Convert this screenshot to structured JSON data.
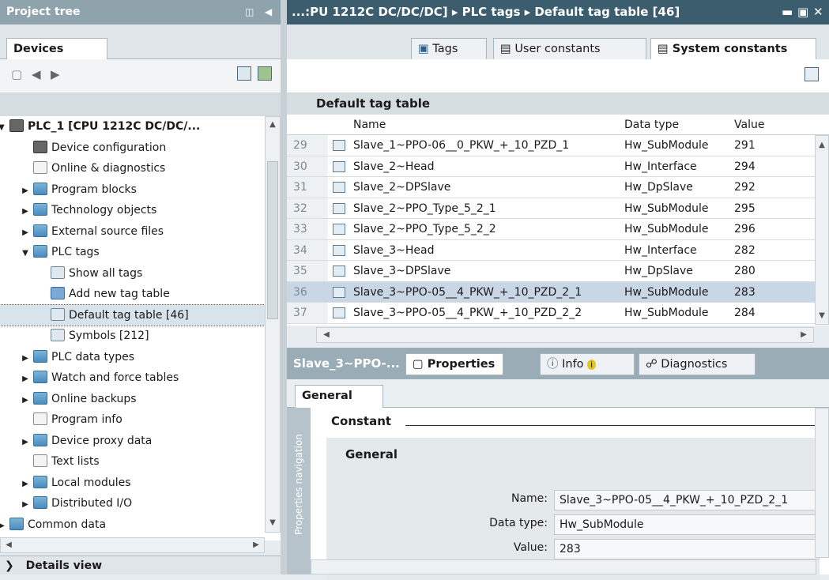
{
  "left": {
    "title": "Project tree",
    "tab": "Devices",
    "tree": [
      {
        "label": "PLC_1 [CPU 1212C DC/DC/...",
        "level": 0,
        "expand": "open",
        "icon": "cpu-icon"
      },
      {
        "label": "Device configuration",
        "level": 1,
        "expand": "",
        "icon": "device-config-icon"
      },
      {
        "label": "Online & diagnostics",
        "level": 1,
        "expand": "",
        "icon": "diagnostics-icon"
      },
      {
        "label": "Program blocks",
        "level": 1,
        "expand": "closed",
        "icon": "folder-icon"
      },
      {
        "label": "Technology objects",
        "level": 1,
        "expand": "closed",
        "icon": "folder-icon"
      },
      {
        "label": "External source files",
        "level": 1,
        "expand": "closed",
        "icon": "folder-icon"
      },
      {
        "label": "PLC tags",
        "level": 1,
        "expand": "open",
        "icon": "folder-icon"
      },
      {
        "label": "Show all tags",
        "level": 2,
        "expand": "",
        "icon": "tags-icon"
      },
      {
        "label": "Add new tag table",
        "level": 2,
        "expand": "",
        "icon": "add-table-icon"
      },
      {
        "label": "Default tag table [46]",
        "level": 2,
        "expand": "",
        "icon": "tag-table-icon",
        "selected": true
      },
      {
        "label": "Symbols [212]",
        "level": 2,
        "expand": "",
        "icon": "tag-table-icon"
      },
      {
        "label": "PLC data types",
        "level": 1,
        "expand": "closed",
        "icon": "folder-icon"
      },
      {
        "label": "Watch and force tables",
        "level": 1,
        "expand": "closed",
        "icon": "folder-icon"
      },
      {
        "label": "Online backups",
        "level": 1,
        "expand": "closed",
        "icon": "folder-icon"
      },
      {
        "label": "Program info",
        "level": 1,
        "expand": "",
        "icon": "program-info-icon"
      },
      {
        "label": "Device proxy data",
        "level": 1,
        "expand": "closed",
        "icon": "folder-icon"
      },
      {
        "label": "Text lists",
        "level": 1,
        "expand": "",
        "icon": "text-list-icon"
      },
      {
        "label": "Local modules",
        "level": 1,
        "expand": "closed",
        "icon": "folder-icon"
      },
      {
        "label": "Distributed I/O",
        "level": 1,
        "expand": "closed",
        "icon": "folder-icon"
      },
      {
        "label": "Common data",
        "level": 0,
        "expand": "closed",
        "icon": "folder-icon"
      }
    ],
    "details": "Details view"
  },
  "main": {
    "breadcrumb": "...:PU 1212C DC/DC/DC] ▸ PLC tags ▸ Default tag table [46]",
    "tabs": [
      "Tags",
      "User constants",
      "System constants"
    ],
    "table_title": "Default tag table",
    "columns": [
      "Name",
      "Data type",
      "Value"
    ],
    "rows": [
      {
        "num": "29",
        "name": "Slave_1~PPO-06__0_PKW_+_10_PZD_1",
        "type": "Hw_SubModule",
        "value": "291"
      },
      {
        "num": "30",
        "name": "Slave_2~Head",
        "type": "Hw_Interface",
        "value": "294"
      },
      {
        "num": "31",
        "name": "Slave_2~DPSlave",
        "type": "Hw_DpSlave",
        "value": "292"
      },
      {
        "num": "32",
        "name": "Slave_2~PPO_Type_5_2_1",
        "type": "Hw_SubModule",
        "value": "295"
      },
      {
        "num": "33",
        "name": "Slave_2~PPO_Type_5_2_2",
        "type": "Hw_SubModule",
        "value": "296"
      },
      {
        "num": "34",
        "name": "Slave_3~Head",
        "type": "Hw_Interface",
        "value": "282"
      },
      {
        "num": "35",
        "name": "Slave_3~DPSlave",
        "type": "Hw_DpSlave",
        "value": "280"
      },
      {
        "num": "36",
        "name": "Slave_3~PPO-05__4_PKW_+_10_PZD_2_1",
        "type": "Hw_SubModule",
        "value": "283",
        "selected": true
      },
      {
        "num": "37",
        "name": "Slave_3~PPO-05__4_PKW_+_10_PZD_2_2",
        "type": "Hw_SubModule",
        "value": "284"
      }
    ]
  },
  "props": {
    "object": "Slave_3~PPO-...",
    "tabs": [
      "Properties",
      "Info",
      "Diagnostics"
    ],
    "subtab": "General",
    "nav": "Properties navigation",
    "section": "Constant",
    "group": "General",
    "fields": [
      {
        "label": "Name:",
        "value": "Slave_3~PPO-05__4_PKW_+_10_PZD_2_1"
      },
      {
        "label": "Data type:",
        "value": "Hw_SubModule"
      },
      {
        "label": "Value:",
        "value": "283"
      }
    ]
  }
}
